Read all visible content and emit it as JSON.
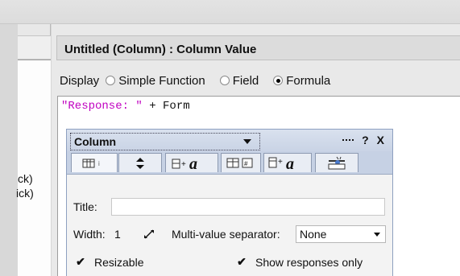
{
  "panel": {
    "title": "Untitled (Column) : Column Value"
  },
  "left_pane": {
    "items": [
      "ck)",
      "ick)"
    ]
  },
  "display": {
    "label": "Display",
    "options": [
      "Simple Function",
      "Field",
      "Formula"
    ],
    "selected": "Formula"
  },
  "formula": {
    "string_part": "\"Response: \"",
    "rest_part": " + Form"
  },
  "properties": {
    "object_selector": "Column",
    "help_label": "?",
    "close_label": "X",
    "tabs": [
      "column-info-icon",
      "sort-icon",
      "column-font-icon",
      "column-format-icon",
      "title-font-icon",
      "advanced-icon"
    ],
    "title_label": "Title:",
    "title_value": "",
    "width_label": "Width:",
    "width_value": "1",
    "separator_label": "Multi-value separator:",
    "separator_value": "None",
    "resizable_label": "Resizable",
    "resizable_checked": true,
    "show_responses_label": "Show responses only",
    "show_responses_checked": true
  }
}
